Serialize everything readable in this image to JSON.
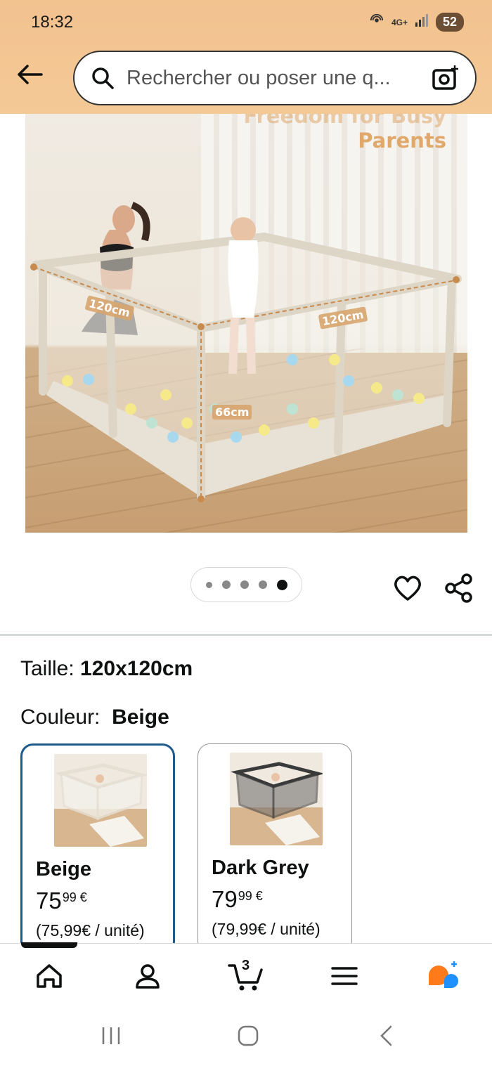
{
  "status_bar": {
    "time": "18:32",
    "network": "4G+",
    "battery": "52"
  },
  "search": {
    "placeholder": "Rechercher ou poser une q..."
  },
  "product_image": {
    "headline_line1": "Freedom for Busy",
    "headline_line2": "Parents",
    "dimensions": [
      "120cm",
      "120cm",
      "66cm"
    ],
    "carousel": {
      "total": 5,
      "active_index": 4
    }
  },
  "details": {
    "size_label": "Taille:",
    "size_value": "120x120cm",
    "color_label": "Couleur:",
    "color_value": "Beige"
  },
  "variants": [
    {
      "name": "Beige",
      "price_whole": "75",
      "price_fraction": "99 €",
      "unit_price": "(75,99€ / unité)",
      "selected": true,
      "frame_color": "#e6e0d4"
    },
    {
      "name": "Dark Grey",
      "price_whole": "79",
      "price_fraction": "99 €",
      "unit_price": "(79,99€ / unité)",
      "selected": false,
      "frame_color": "#3a3a3a"
    }
  ],
  "bottom_nav": {
    "items": [
      "home-icon",
      "account-icon",
      "cart-icon",
      "menu-icon",
      "rufus-icon"
    ],
    "cart_count": "3",
    "active": "home"
  },
  "colors": {
    "header_bg": "#f2c28f",
    "selected_border": "#1f5a8c",
    "rufus_orange": "#ff7a1a",
    "rufus_blue": "#1e90ff"
  }
}
